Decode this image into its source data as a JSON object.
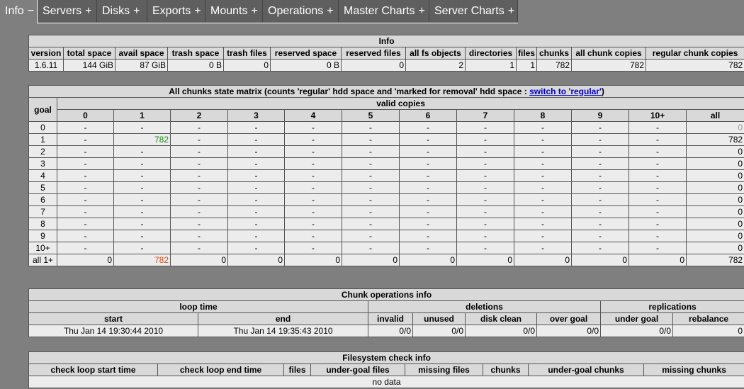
{
  "tabs": [
    {
      "label": "Info",
      "sym": "−",
      "active": true
    },
    {
      "label": "Servers",
      "sym": "+"
    },
    {
      "label": "Disks",
      "sym": "+"
    },
    {
      "label": "Exports",
      "sym": "+"
    },
    {
      "label": "Mounts",
      "sym": "+"
    },
    {
      "label": "Operations",
      "sym": "+"
    },
    {
      "label": "Master Charts",
      "sym": "+"
    },
    {
      "label": "Server Charts",
      "sym": "+"
    }
  ],
  "info": {
    "title": "Info",
    "headers": [
      "version",
      "total space",
      "avail space",
      "trash space",
      "trash files",
      "reserved space",
      "reserved files",
      "all fs objects",
      "directories",
      "files",
      "chunks",
      "all chunk copies",
      "regular chunk copies"
    ],
    "values": [
      "1.6.11",
      "144 GiB",
      "87 GiB",
      "0 B",
      "0",
      "0 B",
      "0",
      "2",
      "1",
      "1",
      "782",
      "782",
      "782"
    ]
  },
  "matrix": {
    "title_prefix": "All chunks state matrix (counts 'regular' hdd space and 'marked for removal' hdd space : ",
    "switch_link": "switch to 'regular'",
    "title_suffix": ")",
    "goal_header": "goal",
    "valid_copies_header": "valid copies",
    "cols": [
      "0",
      "1",
      "2",
      "3",
      "4",
      "5",
      "6",
      "7",
      "8",
      "9",
      "10+",
      "all"
    ],
    "rows": [
      {
        "goal": "0",
        "cells": [
          "-",
          "-",
          "-",
          "-",
          "-",
          "-",
          "-",
          "-",
          "-",
          "-",
          "-",
          "0"
        ]
      },
      {
        "goal": "1",
        "cells": [
          "-",
          "782",
          "-",
          "-",
          "-",
          "-",
          "-",
          "-",
          "-",
          "-",
          "-",
          "782"
        ]
      },
      {
        "goal": "2",
        "cells": [
          "-",
          "-",
          "-",
          "-",
          "-",
          "-",
          "-",
          "-",
          "-",
          "-",
          "-",
          "0"
        ]
      },
      {
        "goal": "3",
        "cells": [
          "-",
          "-",
          "-",
          "-",
          "-",
          "-",
          "-",
          "-",
          "-",
          "-",
          "-",
          "0"
        ]
      },
      {
        "goal": "4",
        "cells": [
          "-",
          "-",
          "-",
          "-",
          "-",
          "-",
          "-",
          "-",
          "-",
          "-",
          "-",
          "0"
        ]
      },
      {
        "goal": "5",
        "cells": [
          "-",
          "-",
          "-",
          "-",
          "-",
          "-",
          "-",
          "-",
          "-",
          "-",
          "-",
          "0"
        ]
      },
      {
        "goal": "6",
        "cells": [
          "-",
          "-",
          "-",
          "-",
          "-",
          "-",
          "-",
          "-",
          "-",
          "-",
          "-",
          "0"
        ]
      },
      {
        "goal": "7",
        "cells": [
          "-",
          "-",
          "-",
          "-",
          "-",
          "-",
          "-",
          "-",
          "-",
          "-",
          "-",
          "0"
        ]
      },
      {
        "goal": "8",
        "cells": [
          "-",
          "-",
          "-",
          "-",
          "-",
          "-",
          "-",
          "-",
          "-",
          "-",
          "-",
          "0"
        ]
      },
      {
        "goal": "9",
        "cells": [
          "-",
          "-",
          "-",
          "-",
          "-",
          "-",
          "-",
          "-",
          "-",
          "-",
          "-",
          "0"
        ]
      },
      {
        "goal": "10+",
        "cells": [
          "-",
          "-",
          "-",
          "-",
          "-",
          "-",
          "-",
          "-",
          "-",
          "-",
          "-",
          "0"
        ]
      },
      {
        "goal": "all 1+",
        "cells": [
          "0",
          "782",
          "0",
          "0",
          "0",
          "0",
          "0",
          "0",
          "0",
          "0",
          "0",
          "782"
        ]
      }
    ]
  },
  "chunkops": {
    "title": "Chunk operations info",
    "loop_time": "loop time",
    "deletions": "deletions",
    "replications": "replications",
    "headers": [
      "start",
      "end",
      "invalid",
      "unused",
      "disk clean",
      "over goal",
      "under goal",
      "rebalance"
    ],
    "values": [
      "Thu Jan 14 19:30:44 2010",
      "Thu Jan 14 19:35:43 2010",
      "0/0",
      "0/0",
      "0/0",
      "0/0",
      "0/0",
      "0"
    ]
  },
  "fscheck": {
    "title": "Filesystem check info",
    "headers": [
      "check loop start time",
      "check loop end time",
      "files",
      "under-goal files",
      "missing files",
      "chunks",
      "under-goal chunks",
      "missing chunks"
    ],
    "no_data": "no data"
  },
  "colors": {
    "green": "#1a8a1a",
    "orange": "#d2541e",
    "link": "#0000cc",
    "tab_bg": "#5f5f5f",
    "page_bg": "#7f7f7f"
  }
}
